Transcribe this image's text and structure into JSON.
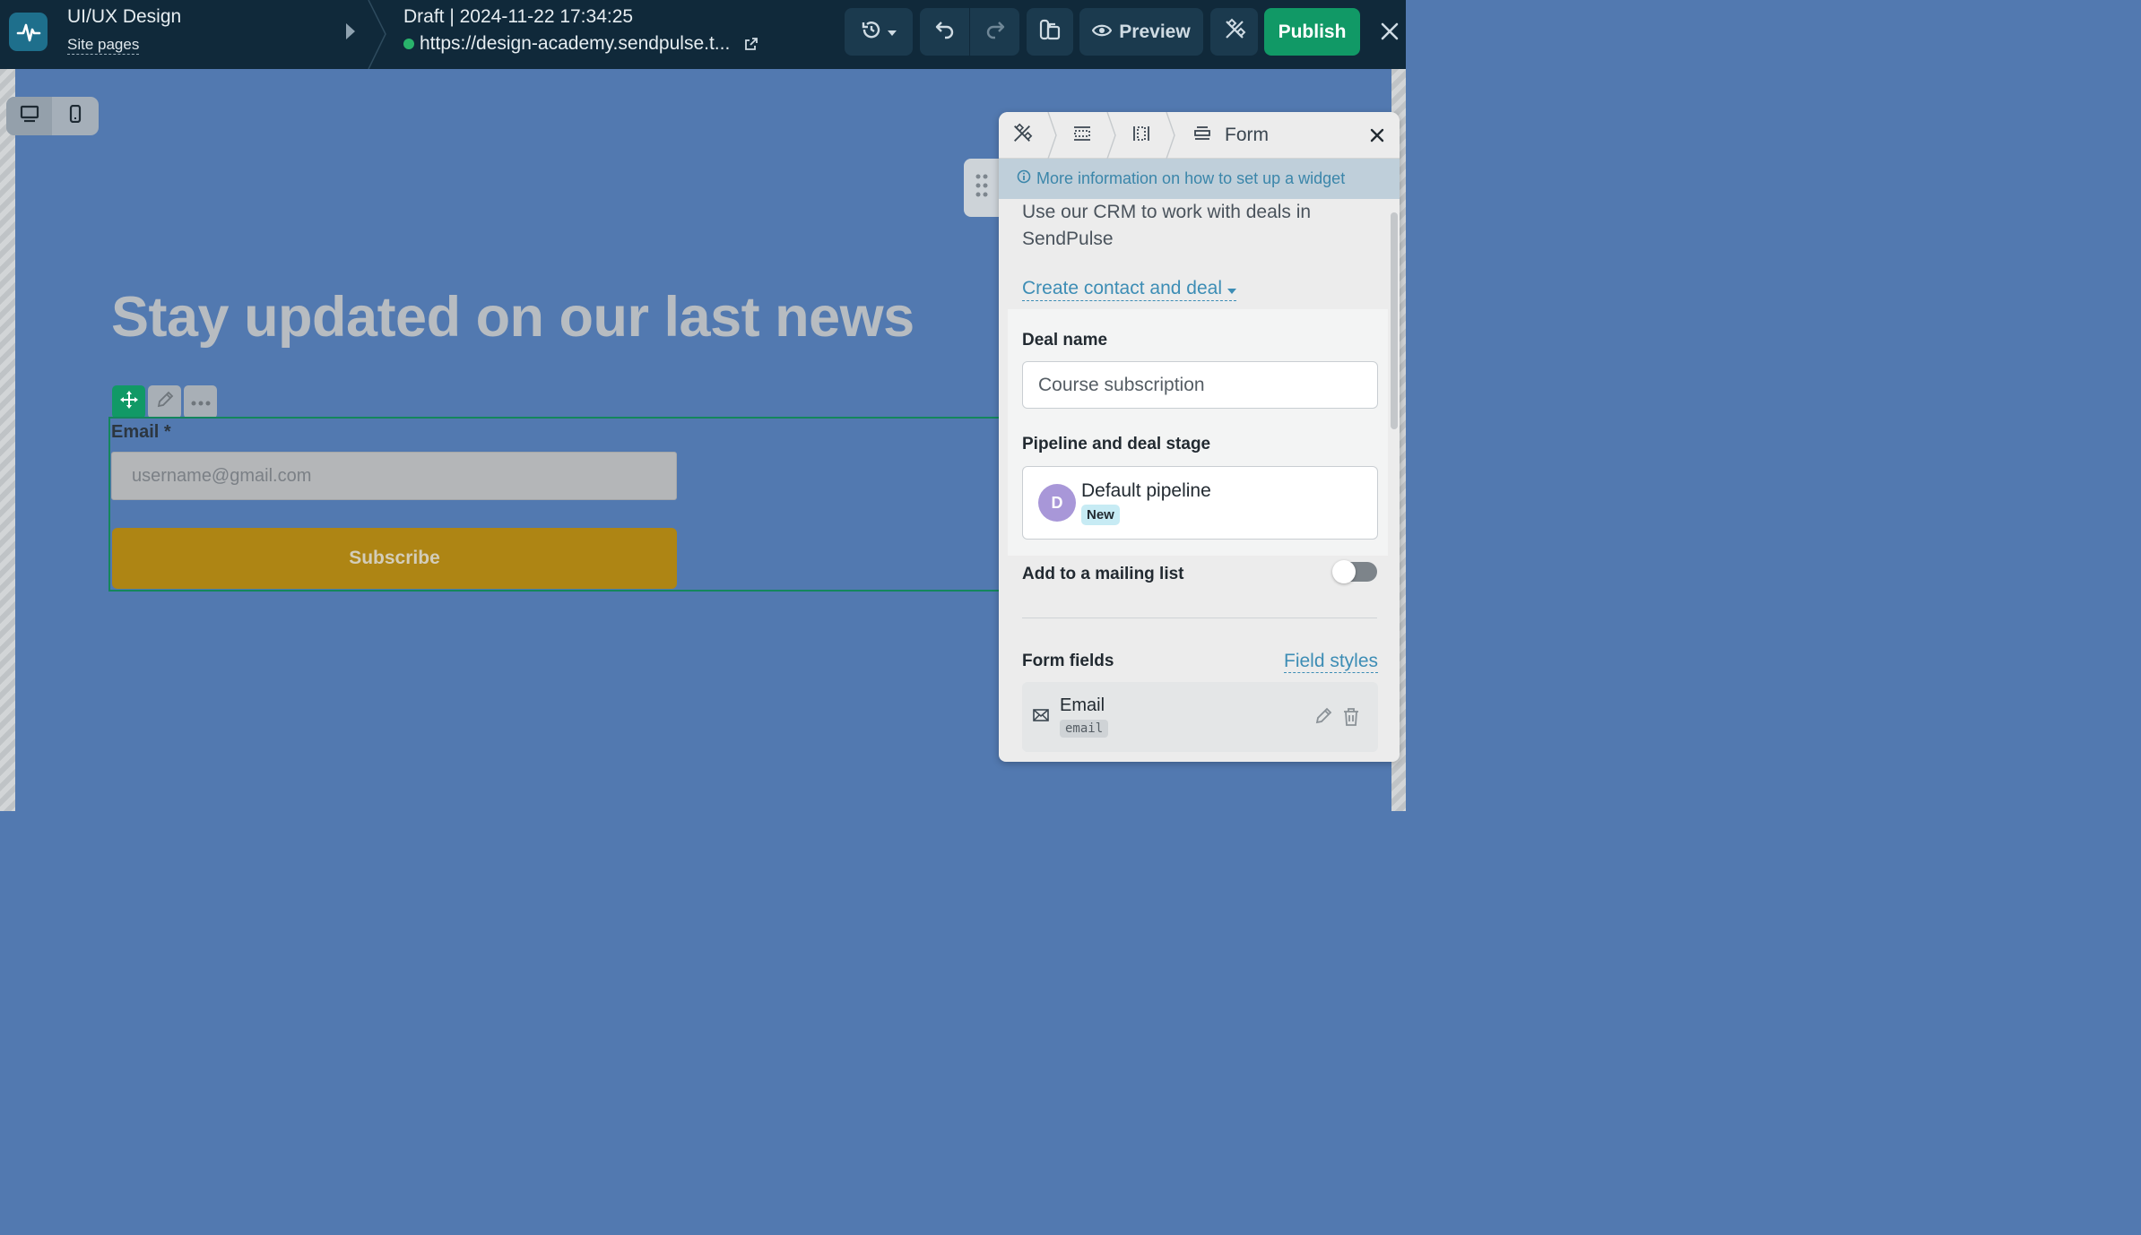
{
  "topbar": {
    "app_title": "UI/UX Design",
    "site_pages": "Site pages",
    "draft": "Draft | 2024-11-22 17:34:25",
    "url": "https://design-academy.sendpulse.t...",
    "preview_label": "Preview",
    "publish_label": "Publish",
    "colors": {
      "background": "#10293a",
      "publish": "#119966"
    }
  },
  "canvas": {
    "headline": "Stay updated on our last news",
    "email_label": "Email *",
    "email_placeholder": "username@gmail.com",
    "subscribe_label": "Subscribe",
    "colors": {
      "background": "#5279b0",
      "subscribe": "#ae8514"
    }
  },
  "panel": {
    "breadcrumb_label": "Form",
    "info_link": "More information on how to set up a widget",
    "intro": "Use our CRM to work with deals in SendPulse",
    "create_dropdown": "Create contact and deal",
    "deal_name_label": "Deal name",
    "deal_name_value": "Course subscription",
    "pipeline_label": "Pipeline and deal stage",
    "pipeline": {
      "avatar": "D",
      "name": "Default pipeline",
      "stage": "New"
    },
    "mailing_label": "Add to a mailing list",
    "mailing_enabled": false,
    "form_fields_label": "Form fields",
    "field_styles_label": "Field styles",
    "fields": [
      {
        "name": "Email",
        "key": "email"
      }
    ]
  }
}
